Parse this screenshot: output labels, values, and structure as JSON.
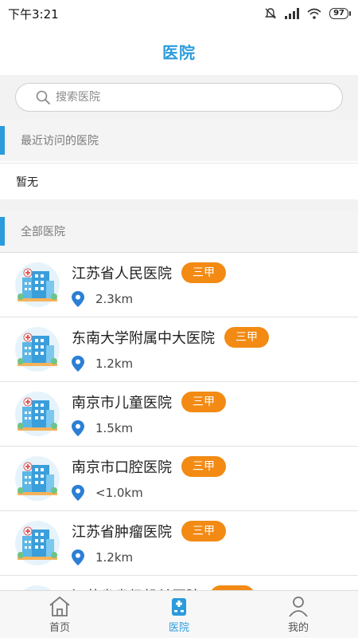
{
  "status_bar": {
    "time": "下午3:21",
    "battery": "97"
  },
  "header": {
    "title": "医院"
  },
  "search": {
    "placeholder": "搜索医院"
  },
  "recent": {
    "title": "最近访问的医院",
    "empty_text": "暂无"
  },
  "all": {
    "title": "全部医院"
  },
  "hospitals": [
    {
      "name": "江苏省人民医院",
      "level": "三甲",
      "distance": "2.3km"
    },
    {
      "name": "东南大学附属中大医院",
      "level": "三甲",
      "distance": "1.2km"
    },
    {
      "name": "南京市儿童医院",
      "level": "三甲",
      "distance": "1.5km"
    },
    {
      "name": "南京市口腔医院",
      "level": "三甲",
      "distance": "<1.0km"
    },
    {
      "name": "江苏省肿瘤医院",
      "level": "三甲",
      "distance": "1.2km"
    },
    {
      "name": "江苏省省级机关医院",
      "level": "三甲",
      "distance": ""
    }
  ],
  "tabbar": {
    "items": [
      {
        "label": "首页",
        "icon": "home-icon"
      },
      {
        "label": "医院",
        "icon": "hospital-icon"
      },
      {
        "label": "我的",
        "icon": "user-icon"
      }
    ]
  },
  "colors": {
    "accent": "#2b9bdc",
    "tag": "#f28a14"
  }
}
